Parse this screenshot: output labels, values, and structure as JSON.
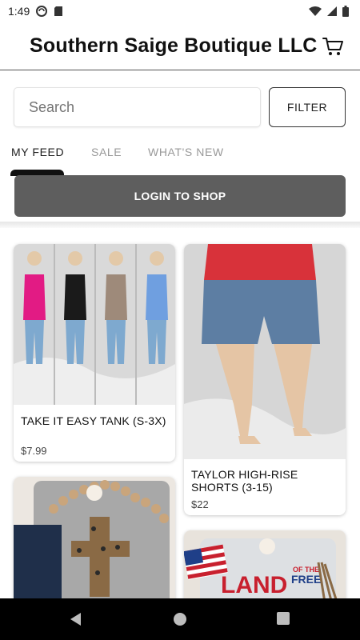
{
  "status": {
    "time": "1:49"
  },
  "app": {
    "title": "Southern Saige Boutique LLC"
  },
  "search": {
    "placeholder": "Search"
  },
  "filter": {
    "label": "FILTER"
  },
  "tabs": [
    {
      "label": "MY FEED"
    },
    {
      "label": "SALE"
    },
    {
      "label": "WHAT'S NEW"
    }
  ],
  "login": {
    "label": "LOGIN TO SHOP"
  },
  "products": [
    {
      "title": "TAKE IT EASY TANK (S-3X)",
      "price": "$7.99"
    },
    {
      "title": "TAYLOR HIGH-RISE SHORTS (3-15)",
      "price": "$22"
    },
    {
      "title": "",
      "price": ""
    },
    {
      "title": "",
      "price": ""
    }
  ],
  "product_images": [
    {
      "graphic_text_1": "LAND",
      "graphic_text_2": "OF THE",
      "graphic_text_3": "FREE"
    }
  ],
  "colors": {
    "login_button": "#5e5e5e",
    "tab_active": "#111111"
  }
}
